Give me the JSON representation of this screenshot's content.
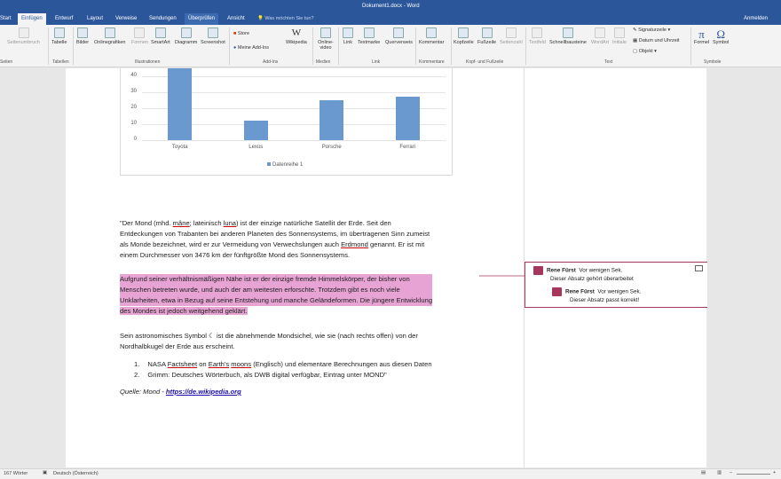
{
  "titlebar": {
    "doc_title": "Dokument1.docx - Word",
    "tell_me": "Was möchten Sie tun?",
    "sign_in": "Anmelden",
    "tabs": [
      "Start",
      "Einfügen",
      "Entwurf",
      "Layout",
      "Verweise",
      "Sendungen",
      "Überprüfen",
      "Ansicht"
    ],
    "active_tab": "Einfügen",
    "hover_tab": "Überprüfen"
  },
  "ribbon": {
    "buttons": [
      "Seitenumbruch",
      "Tabelle",
      "Bilder",
      "Onlinegrafiken",
      "Formen",
      "SmartArt",
      "Diagramm",
      "Screenshot",
      "Meine Add-Ins",
      "Wikipedia",
      "Online-video",
      "Link",
      "Textmarke",
      "Querverweis",
      "Kommentar",
      "Kopfzeile",
      "Fußzeile",
      "Seitenzahl",
      "Textfeld",
      "Schnellbausteine",
      "WordArt",
      "Initiale",
      "Formel",
      "Symbol"
    ],
    "store": "Store",
    "small": [
      "Signaturzeile",
      "Datum und Uhrzeit",
      "Objekt"
    ],
    "groups": [
      "Seiten",
      "Tabellen",
      "Illustrationen",
      "Add-Ins",
      "Medien",
      "Link",
      "Kommentare",
      "Kopf- und Fußzeile",
      "Text",
      "Symbole"
    ]
  },
  "chart_data": {
    "type": "bar",
    "categories": [
      "Toyota",
      "Lexus",
      "Porsche",
      "Ferrari"
    ],
    "values": [
      47,
      12,
      25,
      27
    ],
    "yticks": [
      "0",
      "10",
      "20",
      "30",
      "40"
    ],
    "ylim": [
      0,
      40
    ],
    "legend": "Datenreihe 1",
    "legend_position": "bottom",
    "grid": true
  },
  "body": {
    "p1": [
      "\"Der Mond (mhd. ",
      "mâne",
      "; lateinisch ",
      "luna",
      ") ist der einzige natürliche Satellit der Erde. Seit den"
    ],
    "p1b": "Entdeckungen von Trabanten bei anderen Planeten des Sonnensystems, im übertragenen Sinn zumeist",
    "p1c": [
      "als Monde bezeichnet, wird er zur Vermeidung von Verwechslungen auch ",
      "Erdmond",
      " genannt. Er ist mit"
    ],
    "p1d": "einem Durchmesser von 3476 km der fünftgrößte Mond des Sonnensystems.",
    "p2": [
      "Aufgrund seiner verhältnismäßigen Nähe ist er der einzige fremde Himmelskörper, der bisher von",
      "Menschen betreten wurde, und auch der am weitesten erforschte. Trotzdem gibt es noch viele",
      "Unklarheiten, etwa in Bezug auf seine Entstehung und manche Geländeformen. Die jüngere Entwicklung",
      "des Mondes ist jedoch weitgehend geklärt."
    ],
    "p3a": "Sein astronomisches Symbol ☾ ist die abnehmende Mondsichel, wie sie (nach rechts offen) von der",
    "p3b": "Nordhalbkugel der Erde aus erscheint.",
    "list1": [
      "1.",
      "NASA ",
      "Factsheet",
      " on ",
      "Earth's",
      " ",
      "moons",
      " (Englisch) und elementare Berechnungen aus diesen Daten"
    ],
    "list2": [
      "2.",
      "Grimm: Deutsches Wörterbuch, als DWB digital verfügbar, Eintrag unter MOND\""
    ],
    "source": [
      "Quelle: Mond - ",
      "https://de.wikipedia.org"
    ]
  },
  "comments": [
    {
      "author": "Rene Fürst",
      "time": "Vor wenigen Sek.",
      "text": "Dieser Absatz gehört überarbeitet"
    },
    {
      "author": "Rene Fürst",
      "time": "Vor wenigen Sek.",
      "text": "Dieser Absatz passt korrekt!"
    }
  ],
  "status": {
    "words": "167 Wörter",
    "language": "Deutsch (Österreich)"
  },
  "colors": {
    "accent": "#2b579a",
    "bar": "#6a99d0",
    "highlight": "#e7a3d3",
    "comment": "#a6365a"
  }
}
